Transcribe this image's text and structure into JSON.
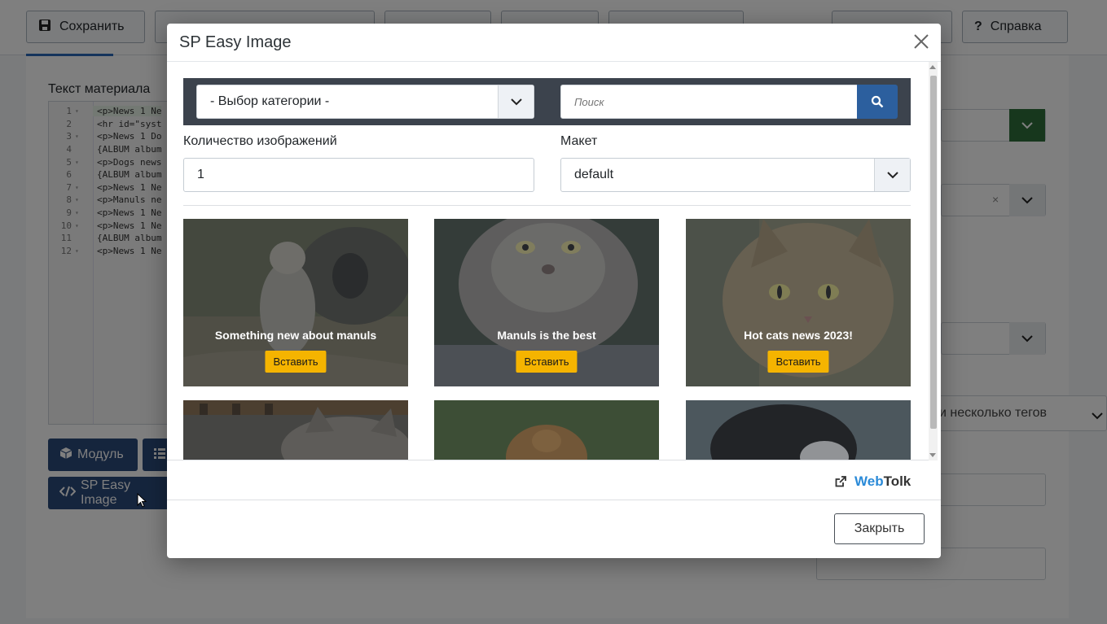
{
  "toolbar": {
    "save_label": "Сохранить",
    "help_label": "Справка"
  },
  "editor": {
    "field_label": "Текст материала",
    "lines": [
      {
        "n": "1",
        "fold": true,
        "text": "<p>News 1 Ne"
      },
      {
        "n": "2",
        "fold": false,
        "text": "<hr id=\"syst"
      },
      {
        "n": "3",
        "fold": true,
        "text": "<p>News 1 Do"
      },
      {
        "n": "4",
        "fold": false,
        "text": "{ALBUM album"
      },
      {
        "n": "5",
        "fold": true,
        "text": "<p>Dogs news"
      },
      {
        "n": "6",
        "fold": false,
        "text": "{ALBUM album"
      },
      {
        "n": "7",
        "fold": true,
        "text": "<p>News 1 Ne"
      },
      {
        "n": "8",
        "fold": true,
        "text": "<p>Manuls ne"
      },
      {
        "n": "9",
        "fold": true,
        "text": "<p>News 1 Ne"
      },
      {
        "n": "10",
        "fold": true,
        "text": "<p>News 1 Ne"
      },
      {
        "n": "11",
        "fold": false,
        "text": "{ALBUM album"
      },
      {
        "n": "12",
        "fold": true,
        "text": "<p>News 1 Ne"
      }
    ],
    "module_button": "Модуль",
    "sp_easy_button": "SP Easy Image"
  },
  "right_panel": {
    "tags_placeholder": "и несколько тегов",
    "clear_symbol": "×"
  },
  "modal": {
    "title": "SP Easy Image",
    "category_select": "- Выбор категории -",
    "search_placeholder": "Поиск",
    "count_label": "Количество изображений",
    "count_value": "1",
    "layout_label": "Макет",
    "layout_value": "default",
    "insert_label": "Вставить",
    "cards": [
      {
        "caption": "Something new about manuls",
        "photo": "manul-on-log"
      },
      {
        "caption": "Manuls is the best",
        "photo": "manul-closeup"
      },
      {
        "caption": "Hot cats news 2023!",
        "photo": "tabby-cat"
      }
    ],
    "cards_row2": [
      {
        "photo": "tabby-cat-lying"
      },
      {
        "photo": "golden-retriever"
      },
      {
        "photo": "black-white-dog"
      }
    ],
    "brand": {
      "web": "Web",
      "tolk": "Tolk"
    },
    "close_button": "Закрыть"
  },
  "colors": {
    "accent_blue": "#2c5f9e",
    "insert_yellow": "#f5b400",
    "brand_blue": "#2a8ad8",
    "dark_bar": "#3c434d"
  }
}
